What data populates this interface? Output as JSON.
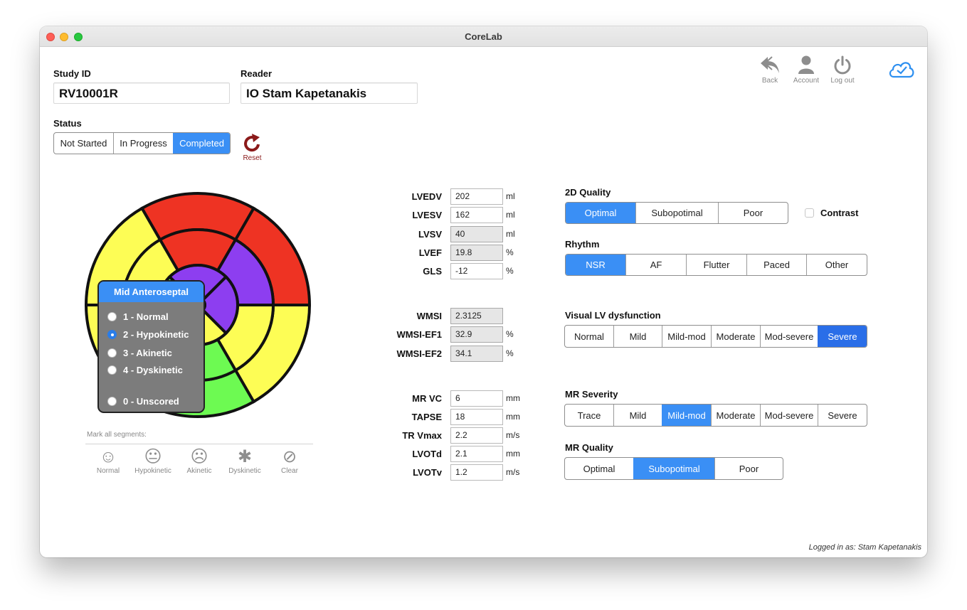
{
  "window": {
    "title": "CoreLab"
  },
  "study": {
    "label": "Study ID",
    "value": "RV10001R"
  },
  "reader": {
    "label": "Reader",
    "value": "IO Stam Kapetanakis"
  },
  "status": {
    "label": "Status",
    "options": [
      "Not Started",
      "In Progress",
      "Completed"
    ],
    "selected": "Completed"
  },
  "reset": {
    "label": "Reset"
  },
  "toolbar": {
    "back": "Back",
    "account": "Account",
    "logout": "Log out"
  },
  "bullseye": {
    "segment_colors": {
      "red": "#ee3323",
      "yellow": "#fdfd55",
      "green": "#6dfa52",
      "purple": "#8d3ef0"
    }
  },
  "segment_popup": {
    "title": "Mid Anteroseptal",
    "options": [
      "1 - Normal",
      "2 - Hypokinetic",
      "3 - Akinetic",
      "4 - Dyskinetic",
      "0 - Unscored"
    ],
    "selected": "2 - Hypokinetic"
  },
  "mark_all": {
    "label": "Mark all segments:",
    "items": [
      "Normal",
      "Hypokinetic",
      "Akinetic",
      "Dyskinetic",
      "Clear"
    ]
  },
  "measurements_volume": [
    {
      "label": "LVEDV",
      "value": "202",
      "unit": "ml",
      "readonly": false
    },
    {
      "label": "LVESV",
      "value": "162",
      "unit": "ml",
      "readonly": false
    },
    {
      "label": "LVSV",
      "value": "40",
      "unit": "ml",
      "readonly": true
    },
    {
      "label": "LVEF",
      "value": "19.8",
      "unit": "%",
      "readonly": true
    },
    {
      "label": "GLS",
      "value": "-12",
      "unit": "%",
      "readonly": false
    }
  ],
  "measurements_wmsi": [
    {
      "label": "WMSI",
      "value": "2.3125",
      "unit": "",
      "readonly": true
    },
    {
      "label": "WMSI-EF1",
      "value": "32.9",
      "unit": "%",
      "readonly": true
    },
    {
      "label": "WMSI-EF2",
      "value": "34.1",
      "unit": "%",
      "readonly": true
    }
  ],
  "measurements_other": [
    {
      "label": "MR VC",
      "value": "6",
      "unit": "mm",
      "readonly": false
    },
    {
      "label": "TAPSE",
      "value": "18",
      "unit": "mm",
      "readonly": false
    },
    {
      "label": "TR Vmax",
      "value": "2.2",
      "unit": "m/s",
      "readonly": false
    },
    {
      "label": "LVOTd",
      "value": "2.1",
      "unit": "mm",
      "readonly": false
    },
    {
      "label": "LVOTv",
      "value": "1.2",
      "unit": "m/s",
      "readonly": false
    }
  ],
  "quality_2d": {
    "label": "2D Quality",
    "options": [
      "Optimal",
      "Subopotimal",
      "Poor"
    ],
    "selected": "Optimal"
  },
  "contrast": {
    "label": "Contrast",
    "checked": false
  },
  "rhythm": {
    "label": "Rhythm",
    "options": [
      "NSR",
      "AF",
      "Flutter",
      "Paced",
      "Other"
    ],
    "selected": "NSR"
  },
  "lv_dysfunction": {
    "label": "Visual LV dysfunction",
    "options": [
      "Normal",
      "Mild",
      "Mild-mod",
      "Moderate",
      "Mod-severe",
      "Severe"
    ],
    "selected": "Severe"
  },
  "mr_severity": {
    "label": "MR Severity",
    "options": [
      "Trace",
      "Mild",
      "Mild-mod",
      "Moderate",
      "Mod-severe",
      "Severe"
    ],
    "selected": "Mild-mod"
  },
  "mr_quality": {
    "label": "MR Quality",
    "options": [
      "Optimal",
      "Subopotimal",
      "Poor"
    ],
    "selected": "Subopotimal"
  },
  "footer": {
    "logged_in": "Logged in as: Stam Kapetanakis"
  },
  "icons": {
    "back": "back-arrow-icon",
    "account": "person-icon",
    "logout": "power-icon",
    "sync": "cloud-check-icon",
    "reset": "reset-arrow-icon"
  }
}
